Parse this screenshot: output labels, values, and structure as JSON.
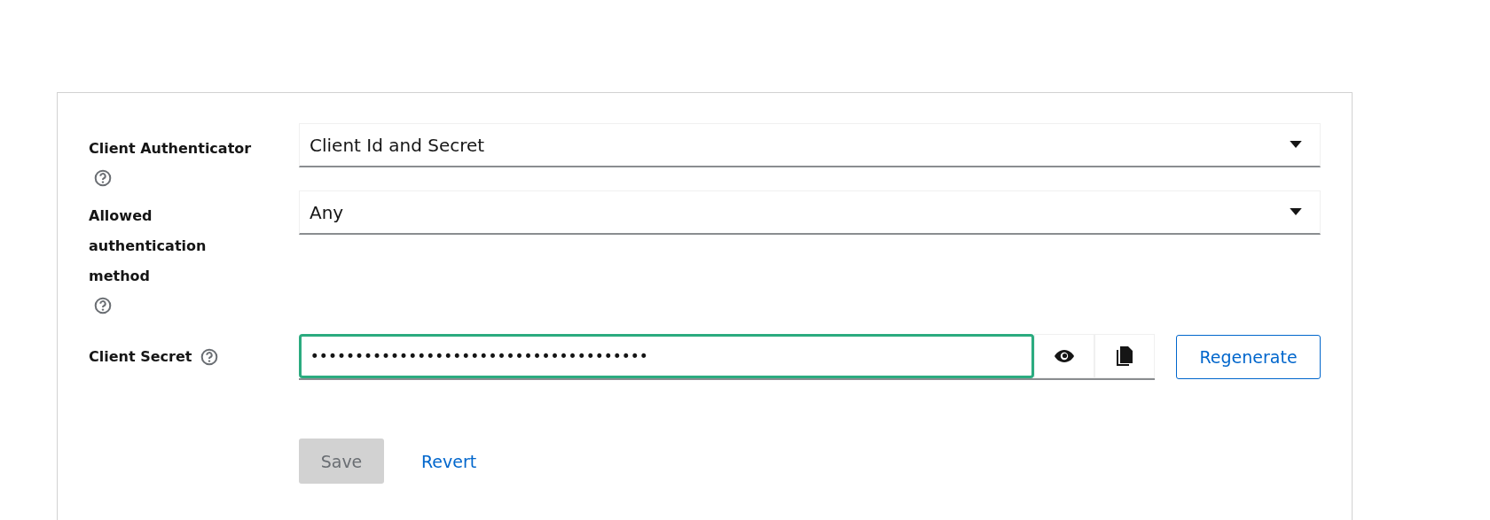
{
  "form": {
    "fields": [
      {
        "kind": "select",
        "label": "Client Authenticator",
        "value": "Client Id and Secret"
      },
      {
        "kind": "select",
        "label": "Allowed authentication method",
        "value": "Any"
      },
      {
        "kind": "secret",
        "label": "Client Secret",
        "value": "••••••••••••••••••••••••••••••••••••••",
        "focused": true,
        "action": "Regenerate"
      }
    ],
    "buttons": [
      {
        "label": "Save",
        "disabled": true,
        "kind": "primary"
      },
      {
        "label": "Revert",
        "disabled": false,
        "kind": "link"
      }
    ]
  }
}
